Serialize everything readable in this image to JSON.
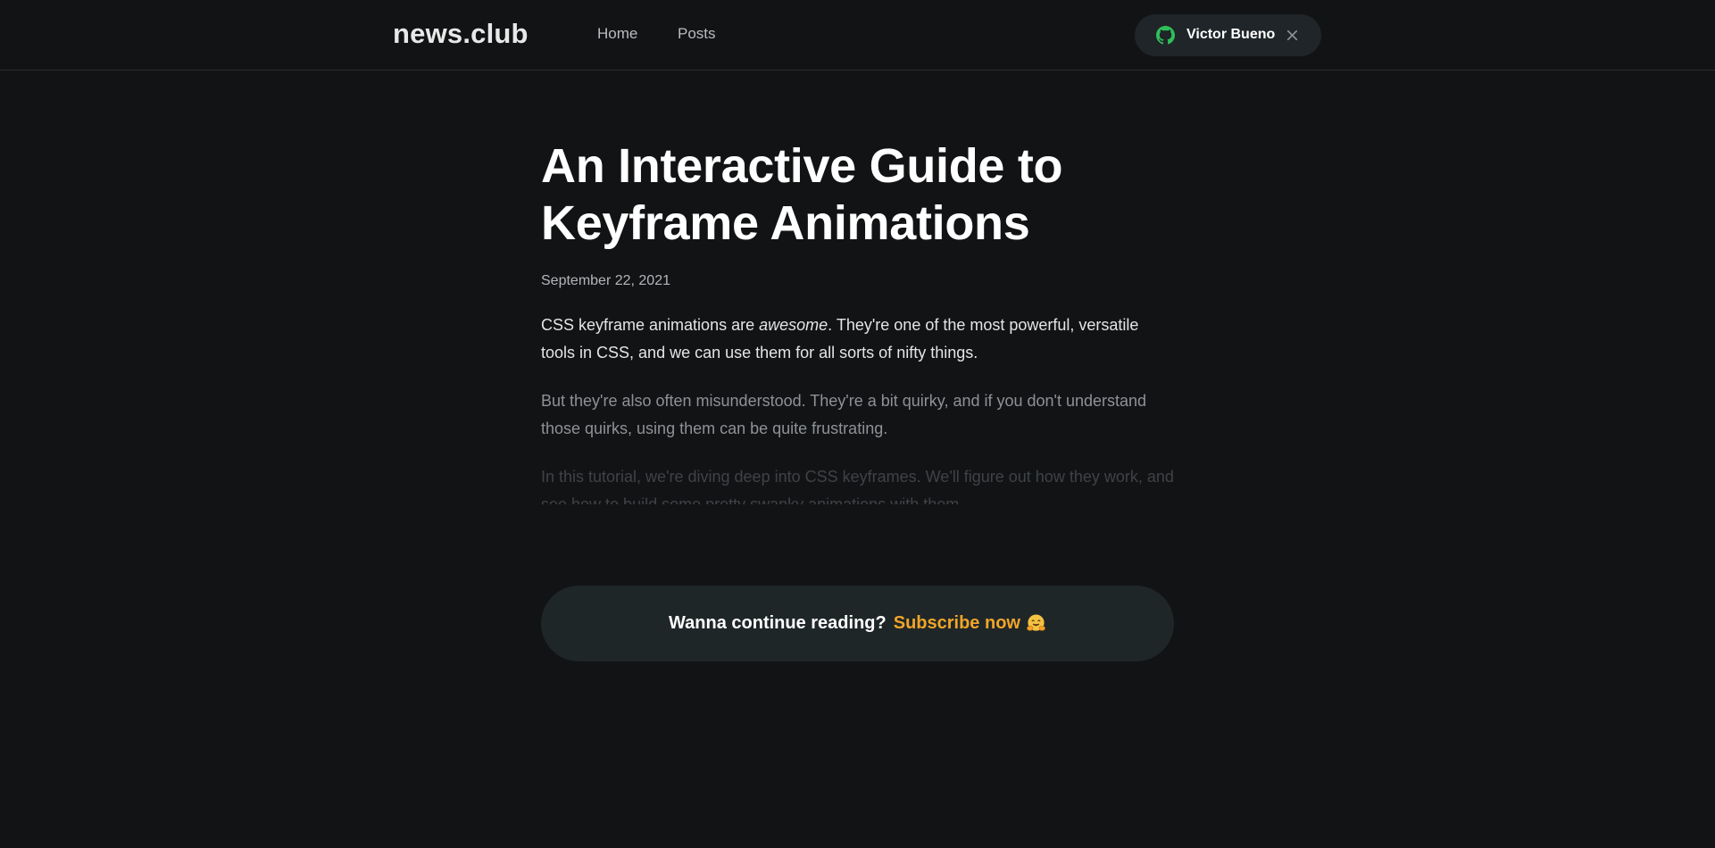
{
  "header": {
    "logo": "news.club",
    "nav": [
      {
        "label": "Home"
      },
      {
        "label": "Posts"
      }
    ],
    "user": {
      "name": "Victor Bueno",
      "icon": "github-icon",
      "close_icon": "close-icon"
    }
  },
  "article": {
    "title_line1": "An Interactive Guide to",
    "title_line2": "Keyframe Animations",
    "date": "September 22, 2021",
    "p1_before": "CSS keyframe animations are ",
    "p1_em": "awesome",
    "p1_after": ". They're one of the most powerful, versatile tools in CSS, and we can use them for all sorts of nifty things.",
    "p2": "But they're also often misunderstood. They're a bit quirky, and if you don't understand those quirks, using them can be quite frustrating.",
    "p3": "In this tutorial, we're diving deep into CSS keyframes. We'll figure out how they work, and see how to build some pretty swanky animations with them."
  },
  "subscribe": {
    "question": "Wanna continue reading?",
    "link": "Subscribe now",
    "emoji": "hugging-face-emoji"
  },
  "colors": {
    "background": "#121315",
    "accent": "#f0a52a",
    "github_green": "#2fbf5a",
    "pill_bg": "#1f2528"
  }
}
